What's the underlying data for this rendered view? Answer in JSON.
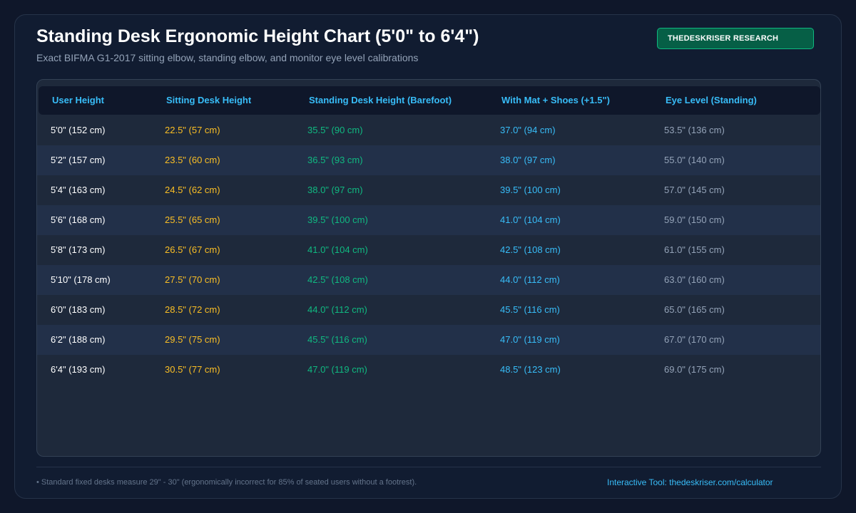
{
  "header": {
    "title": "Standing Desk Ergonomic Height Chart (5'0\" to 6'4\")",
    "subtitle": "Exact BIFMA G1-2017 sitting elbow, standing elbow, and monitor eye level calibrations",
    "badge": "THEDESKRISER RESEARCH"
  },
  "colors": {
    "background": "#0f172a",
    "panel": "#1e293b",
    "header_accent": "#38bdf8",
    "sitting": "#fbbf24",
    "standing": "#10b981",
    "with_mat": "#38bdf8",
    "eye_level": "#94a3b8",
    "badge_bg": "#065f46"
  },
  "table": {
    "columns": [
      "User Height",
      "Sitting Desk Height",
      "Standing Desk Height (Barefoot)",
      "With Mat + Shoes (+1.5\")",
      "Eye Level (Standing)"
    ],
    "rows": [
      [
        "5'0\" (152 cm)",
        "22.5\" (57 cm)",
        "35.5\" (90 cm)",
        "37.0\" (94 cm)",
        "53.5\" (136 cm)"
      ],
      [
        "5'2\" (157 cm)",
        "23.5\" (60 cm)",
        "36.5\" (93 cm)",
        "38.0\" (97 cm)",
        "55.0\" (140 cm)"
      ],
      [
        "5'4\" (163 cm)",
        "24.5\" (62 cm)",
        "38.0\" (97 cm)",
        "39.5\" (100 cm)",
        "57.0\" (145 cm)"
      ],
      [
        "5'6\" (168 cm)",
        "25.5\" (65 cm)",
        "39.5\" (100 cm)",
        "41.0\" (104 cm)",
        "59.0\" (150 cm)"
      ],
      [
        "5'8\" (173 cm)",
        "26.5\" (67 cm)",
        "41.0\" (104 cm)",
        "42.5\" (108 cm)",
        "61.0\" (155 cm)"
      ],
      [
        "5'10\" (178 cm)",
        "27.5\" (70 cm)",
        "42.5\" (108 cm)",
        "44.0\" (112 cm)",
        "63.0\" (160 cm)"
      ],
      [
        "6'0\" (183 cm)",
        "28.5\" (72 cm)",
        "44.0\" (112 cm)",
        "45.5\" (116 cm)",
        "65.0\" (165 cm)"
      ],
      [
        "6'2\" (188 cm)",
        "29.5\" (75 cm)",
        "45.5\" (116 cm)",
        "47.0\" (119 cm)",
        "67.0\" (170 cm)"
      ],
      [
        "6'4\" (193 cm)",
        "30.5\" (77 cm)",
        "47.0\" (119 cm)",
        "48.5\" (123 cm)",
        "69.0\" (175 cm)"
      ]
    ]
  },
  "footer": {
    "note": "• Standard fixed desks measure 29\" - 30\" (ergonomically incorrect for 85% of seated users without a footrest).",
    "link": "Interactive Tool: thedeskriser.com/calculator"
  }
}
